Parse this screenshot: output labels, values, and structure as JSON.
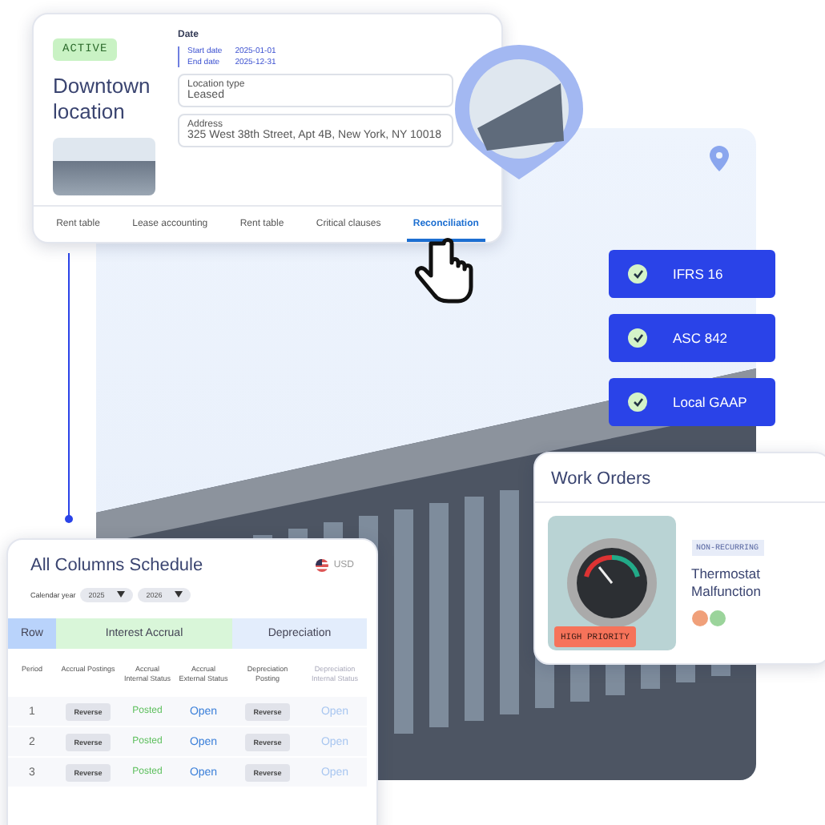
{
  "property": {
    "status": "ACTIVE",
    "name": "Downtown location",
    "date_label": "Date",
    "dates": [
      {
        "label": "Start date",
        "value": "2025-01-01"
      },
      {
        "label": "End date",
        "value": "2025-12-31"
      }
    ],
    "fields": [
      {
        "label": "Location type",
        "value": "Leased"
      },
      {
        "label": "Address",
        "value": "325 West 38th Street, Apt 4B, New York, NY 10018"
      }
    ],
    "tabs": [
      {
        "label": "Rent table",
        "selected": false
      },
      {
        "label": "Lease accounting",
        "selected": false
      },
      {
        "label": "Rent table",
        "selected": false
      },
      {
        "label": "Critical clauses",
        "selected": false
      },
      {
        "label": "Reconciliation",
        "selected": true
      }
    ]
  },
  "standards": [
    {
      "label": "IFRS 16",
      "checked": true
    },
    {
      "label": "ASC 842",
      "checked": true
    },
    {
      "label": "Local GAAP",
      "checked": true
    }
  ],
  "work_orders": {
    "title": "Work Orders",
    "tag": "NON-RECURRING",
    "priority": "HIGH PRIORITY",
    "item": "Thermostat Malfunction"
  },
  "schedule": {
    "title": "All Columns Schedule",
    "currency": "USD",
    "year_label": "Calendar year",
    "years": [
      "2025",
      "2026"
    ],
    "groups": [
      {
        "label": "Row",
        "color": "#b9d3fb"
      },
      {
        "label": "Interest Accrual",
        "color": "#d9f6d9"
      },
      {
        "label": "Depreciation",
        "color": "#e3edfc"
      }
    ],
    "columns": [
      "Period",
      "Accrual Postings",
      "Accrual Internal Status",
      "Accrual External Status",
      "Depreciation Posting",
      "Depreciation Internal Status"
    ],
    "rows": [
      {
        "period": "1",
        "posting": "Reverse",
        "internal": "Posted",
        "external": "Open",
        "dep_posting": "Reverse",
        "dep_internal": "Open"
      },
      {
        "period": "2",
        "posting": "Reverse",
        "internal": "Posted",
        "external": "Open",
        "dep_posting": "Reverse",
        "dep_internal": "Open"
      },
      {
        "period": "3",
        "posting": "Reverse",
        "internal": "Posted",
        "external": "Open",
        "dep_posting": "Reverse",
        "dep_internal": "Open"
      }
    ]
  }
}
